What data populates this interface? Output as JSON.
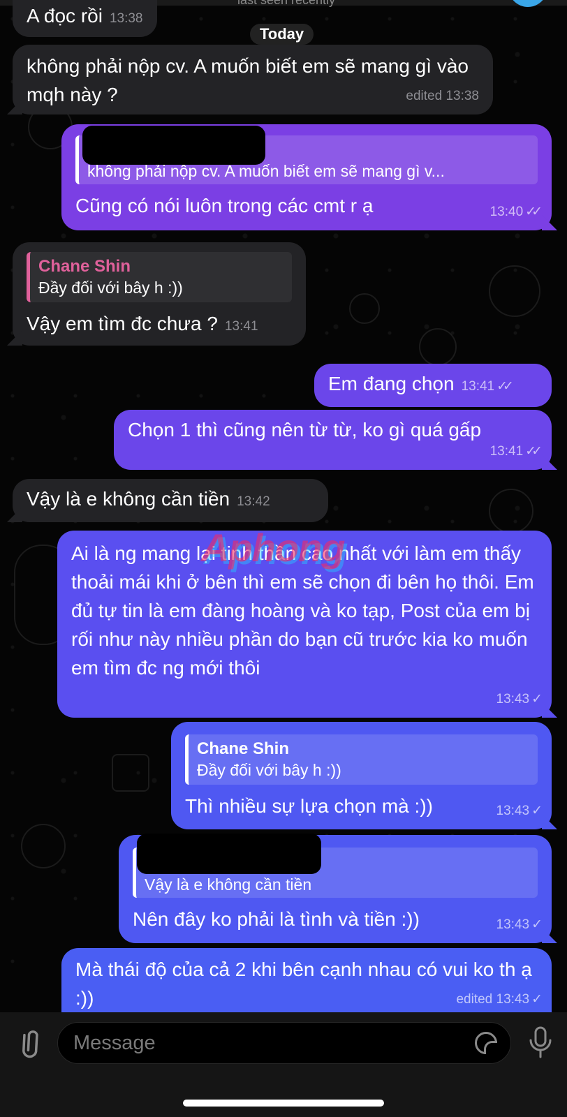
{
  "header": {
    "status": "last seen recently",
    "date_separator": "Today"
  },
  "messages": [
    {
      "id": "m1",
      "dir": "in",
      "text": "A đọc rồi",
      "time": "13:38"
    },
    {
      "id": "m2",
      "dir": "in",
      "text": "không phải nộp cv. A muốn biết em sẽ mang gì vào mqh này ?",
      "time": "edited 13:38"
    },
    {
      "id": "m3",
      "dir": "out",
      "reply_text": "không phải nộp cv. A muốn biết em sẽ mang gì v...",
      "text": "Cũng có nói luôn trong các cmt r ạ",
      "time": "13:40",
      "status": "read"
    },
    {
      "id": "m4",
      "dir": "in",
      "reply_author": "Chane Shin",
      "reply_text": "Đầy đối với bây h :))",
      "text": "Vậy em tìm đc chưa ?",
      "time": "13:41"
    },
    {
      "id": "m5",
      "dir": "out",
      "text": "Em đang chọn",
      "time": "13:41",
      "status": "read"
    },
    {
      "id": "m6",
      "dir": "out",
      "text": "Chọn 1 thì cũng nên từ từ, ko gì quá gấp",
      "time": "13:41",
      "status": "read"
    },
    {
      "id": "m7",
      "dir": "in",
      "text": "Vậy là e không cần tiền",
      "time": "13:42"
    },
    {
      "id": "m8",
      "dir": "out",
      "text": "Ai là ng mang lại tinh thần cao nhất với làm em thấy thoải mái khi ở bên thì em sẽ chọn đi bên họ thôi. Em đủ tự tin là em đàng hoàng và ko tạp, Post của em bị rối như này nhiều phần do bạn cũ trước kia ko muốn em tìm đc ng mới thôi",
      "time": "13:43",
      "status": "sent"
    },
    {
      "id": "m9",
      "dir": "out",
      "reply_author": "Chane Shin",
      "reply_text": "Đầy đối với bây h :))",
      "text": "Thì nhiều sự lựa chọn mà :))",
      "time": "13:43",
      "status": "sent"
    },
    {
      "id": "m10",
      "dir": "out",
      "reply_text": "Vậy là e không cần tiền",
      "text": "Nên đây ko phải là tình và tiền :))",
      "time": "13:43",
      "status": "sent"
    },
    {
      "id": "m11",
      "dir": "out",
      "text": "Mà thái độ của cả 2 khi bên cạnh nhau có vui ko th ạ :))",
      "time": "edited 13:43",
      "status": "sent"
    }
  ],
  "watermark": "Aphong",
  "composer": {
    "placeholder": "Message",
    "attach_icon": "paperclip-icon",
    "sticker_icon": "sticker-icon",
    "mic_icon": "microphone-icon"
  },
  "glyphs": {
    "double_check": "✓✓",
    "single_check": "✓"
  },
  "colors": {
    "incoming_bubble": "#232326",
    "outgoing_bubble_top": "#7b3fe4",
    "outgoing_bubble_bottom": "#4a5ef3",
    "reply_author": "#e0619b"
  }
}
